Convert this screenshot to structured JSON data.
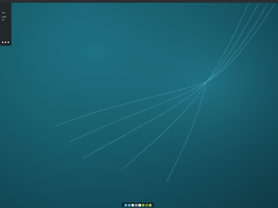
{
  "desktop": {
    "colors": {
      "background": "#18606f",
      "panel": "#2b2f33",
      "swoosh": "#5fc3d6"
    }
  },
  "dock": {
    "items": [
      {
        "name": "start-menu-icon",
        "color": "#3ea6dd"
      },
      {
        "name": "file-manager-icon",
        "color": "#4aa3c8"
      },
      {
        "name": "terminal-icon",
        "color": "#d9d9d9"
      },
      {
        "name": "settings-icon",
        "color": "#8aa0aa"
      },
      {
        "name": "document-icon",
        "color": "#e6e6e6"
      },
      {
        "name": "text-editor-icon",
        "color": "#7fae3b"
      },
      {
        "name": "app-store-icon",
        "color": "#6b8a3a"
      },
      {
        "name": "media-icon",
        "color": "#9ac24d"
      }
    ]
  }
}
